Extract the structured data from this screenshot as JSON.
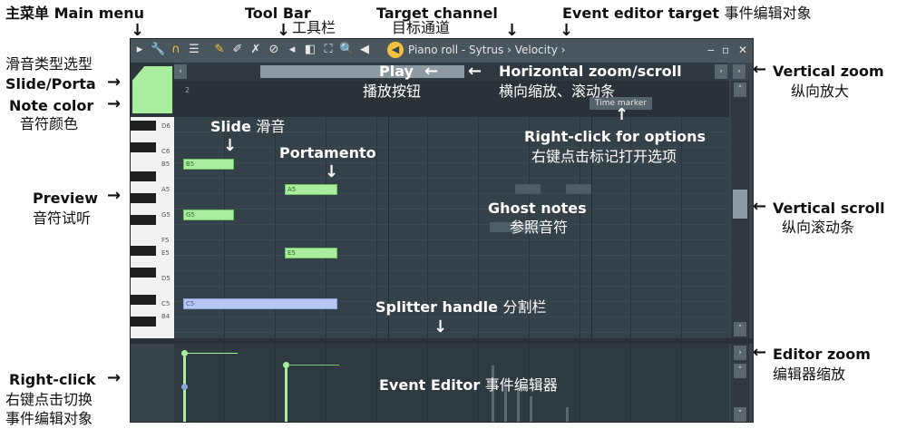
{
  "annotations": {
    "main_menu": {
      "cn": "主菜单",
      "en": "Main menu"
    },
    "tool_bar": {
      "en": "Tool Bar",
      "cn": "工具栏"
    },
    "target_channel": {
      "en": "Target channel",
      "cn": "目标通道"
    },
    "event_editor_target": {
      "en": "Event editor target",
      "cn": "事件编辑对象"
    },
    "slide_porta": {
      "cn": "滑音类型选型",
      "en": "Slide/Porta"
    },
    "note_color": {
      "en": "Note color",
      "cn": "音符颜色"
    },
    "play": {
      "en": "Play",
      "cn": "播放按钮"
    },
    "horizontal_zoom": {
      "en": "Horizontal zoom/scroll",
      "cn": "横向缩放、滚动条"
    },
    "vertical_zoom": {
      "en": "Vertical zoom",
      "cn": "纵向放大"
    },
    "slide": {
      "en": "Slide",
      "cn": "滑音"
    },
    "portamento": {
      "en": "Portamento"
    },
    "right_click_options": {
      "en": "Right-click for options",
      "cn": "右键点击标记打开选项"
    },
    "preview": {
      "en": "Preview",
      "cn": "音符试听"
    },
    "ghost_notes": {
      "en": "Ghost notes",
      "cn": "参照音符"
    },
    "vertical_scroll": {
      "en": "Vertical scroll",
      "cn": "纵向滚动条"
    },
    "splitter": {
      "en": "Splitter handle",
      "cn": "分割栏"
    },
    "editor_zoom": {
      "en": "Editor zoom",
      "cn": "编辑器缩放"
    },
    "event_editor": {
      "en": "Event Editor",
      "cn": "事件编辑器"
    },
    "right_click": {
      "en": "Right-click",
      "cn1": "右键点击切换",
      "cn2": "事件编辑对象"
    }
  },
  "window": {
    "title": "Piano roll - Sytrus",
    "target": "Velocity",
    "time_marker": "Time marker",
    "ruler_number": "2",
    "minimize": "‒",
    "maximize": "▫",
    "close": "✕"
  },
  "keys": {
    "labels": [
      "D6",
      "C6",
      "B5",
      "A5",
      "G5",
      "F5",
      "E5",
      "D5",
      "C5",
      "B4"
    ]
  },
  "notes": [
    {
      "label": "B5"
    },
    {
      "label": "A5"
    },
    {
      "label": "G5"
    },
    {
      "label": "E5"
    },
    {
      "label": "C5"
    }
  ],
  "icons": [
    "menu-arrow-icon",
    "wrench-icon",
    "magnet-icon",
    "list-icon",
    "pencil-icon",
    "brush-icon",
    "delete-icon",
    "mute-icon",
    "slice-icon",
    "select-icon",
    "zoom-icon",
    "speaker-icon",
    "target-icon"
  ],
  "colors": {
    "note_green": "#a8ee9e",
    "note_blue": "#b7c7f4",
    "window_bg": "#3a464d"
  }
}
